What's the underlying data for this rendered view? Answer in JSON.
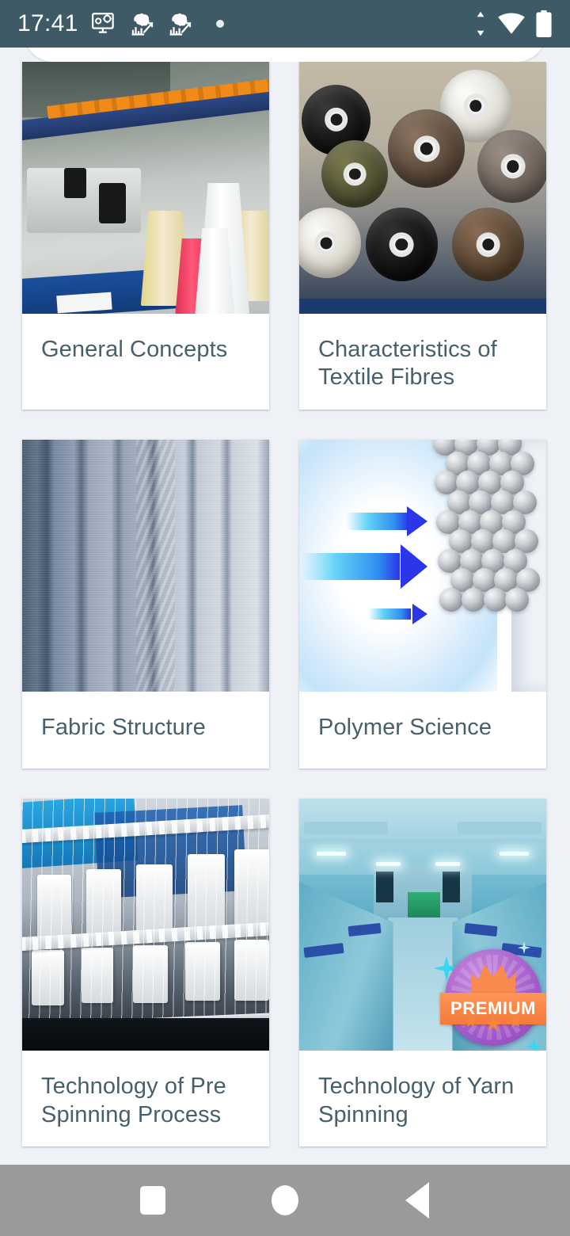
{
  "status_bar": {
    "time": "17:41",
    "background_color": "#3d5a66",
    "left_icons": [
      "monitor-gear-icon",
      "brain-chart-icon",
      "brain-chart-icon",
      "dot-notification-icon"
    ],
    "right_icons": [
      "data-transfer-icon",
      "wifi-icon",
      "battery-icon"
    ]
  },
  "search": {
    "placeholder": "",
    "value": ""
  },
  "grid": {
    "cards": [
      {
        "title": "General Concepts",
        "image": "textile-machine-yarn-cones",
        "premium": false
      },
      {
        "title": "Characteristics of Textile Fibres",
        "image": "thread-spools-assorted-colors",
        "premium": false
      },
      {
        "title": "Fabric Structure",
        "image": "blue-gray-fabric-rolls",
        "premium": false
      },
      {
        "title": "Polymer Science",
        "image": "polymer-spheres-blue-arrows",
        "premium": false
      },
      {
        "title": "Technology of Pre Spinning Process",
        "image": "pre-spinning-machine",
        "premium": false
      },
      {
        "title": "Technology of Yarn Spinning",
        "image": "yarn-spinning-mill-teal",
        "premium": true
      }
    ]
  },
  "premium_badge": {
    "label": "PREMIUM",
    "circle_color": "#a15bc8",
    "band_color": "#f98a4e",
    "sparkle_color": "#36d7f2"
  },
  "nav_bar": {
    "background_color": "#9a9a9a",
    "buttons": [
      {
        "name": "recents",
        "icon": "square-icon"
      },
      {
        "name": "home",
        "icon": "circle-icon"
      },
      {
        "name": "back",
        "icon": "triangle-left-icon"
      }
    ]
  },
  "theme": {
    "page_background": "#eef1f5",
    "card_background": "#ffffff",
    "title_text_color": "#47606c"
  }
}
